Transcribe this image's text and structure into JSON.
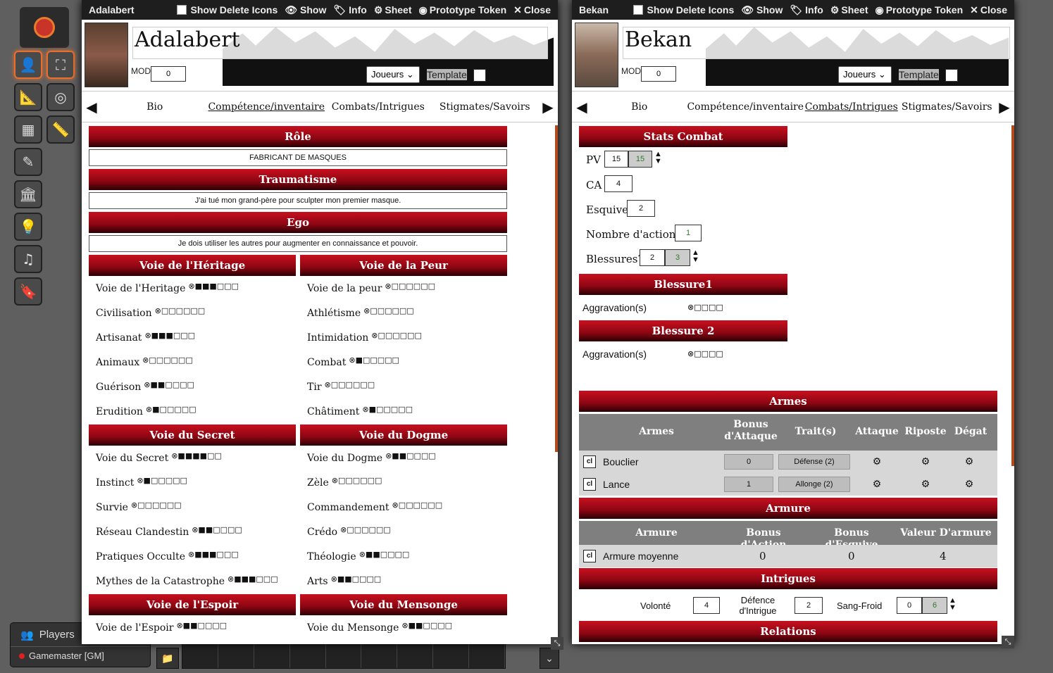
{
  "header_controls": {
    "show_delete": "Show Delete Icons",
    "show": "Show",
    "info": "Info",
    "sheet": "Sheet",
    "proto": "Prototype Token",
    "close": "Close"
  },
  "tabs": {
    "bio": "Bio",
    "comp": "Compétence/inventaire",
    "combat": "Combats/Intrigues",
    "stig": "Stigmates/Savoirs"
  },
  "mod_label": "MOD",
  "template_label": "Template",
  "players": {
    "title": "Players",
    "user": "Gamemaster [GM]"
  },
  "left": {
    "title": "Adalabert",
    "name": "Adalabert",
    "mod": "0",
    "owner": "Joueurs",
    "role_h": "Rôle",
    "role": "FABRICANT DE MASQUES",
    "trauma_h": "Traumatisme",
    "trauma": "J'ai tué mon grand-père pour sculpter mon premier masque.",
    "ego_h": "Ego",
    "ego": "Je dois utiliser les autres pour augmenter en connaissance et pouvoir.",
    "voies": [
      {
        "h": "Voie de l'Héritage",
        "skills": [
          {
            "n": "Voie de l'Heritage",
            "d": "⊗■■■□□□"
          },
          {
            "n": "Civilisation",
            "d": "⊗□□□□□□"
          },
          {
            "n": "Artisanat",
            "d": "⊗■■■□□□"
          },
          {
            "n": "Animaux",
            "d": "⊗□□□□□□"
          },
          {
            "n": "Guérison",
            "d": "⊗■■□□□□"
          },
          {
            "n": "Erudition",
            "d": "⊗■□□□□□"
          }
        ]
      },
      {
        "h": "Voie de la Peur",
        "skills": [
          {
            "n": "Voie de la peur",
            "d": "⊗□□□□□□"
          },
          {
            "n": "Athlétisme",
            "d": "⊗□□□□□□"
          },
          {
            "n": "Intimidation",
            "d": "⊗□□□□□□"
          },
          {
            "n": "Combat",
            "d": "⊗■□□□□□"
          },
          {
            "n": "Tir",
            "d": "⊗□□□□□□"
          },
          {
            "n": "Châtiment",
            "d": "⊗■□□□□□"
          }
        ]
      },
      {
        "h": "Voie du Secret",
        "skills": [
          {
            "n": "Voie du Secret",
            "d": "⊗■■■■□□"
          },
          {
            "n": "Instinct",
            "d": "⊗■□□□□□"
          },
          {
            "n": "Survie",
            "d": "⊗□□□□□□"
          },
          {
            "n": "Réseau Clandestin",
            "d": "⊗■■□□□□"
          },
          {
            "n": "Pratiques Occulte",
            "d": "⊗■■■□□□"
          },
          {
            "n": "Mythes de la Catastrophe",
            "d": "⊗■■■□□□"
          }
        ]
      },
      {
        "h": "Voie du Dogme",
        "skills": [
          {
            "n": "Voie du Dogme",
            "d": "⊗■■□□□□"
          },
          {
            "n": "Zèle",
            "d": "⊗□□□□□□"
          },
          {
            "n": "Commandement",
            "d": "⊗□□□□□□"
          },
          {
            "n": "Crédo",
            "d": "⊗□□□□□□"
          },
          {
            "n": "Théologie",
            "d": "⊗■■□□□□"
          },
          {
            "n": "Arts",
            "d": "⊗■■□□□□"
          }
        ]
      },
      {
        "h": "Voie de l'Espoir",
        "skills": [
          {
            "n": "Voie de l'Espoir",
            "d": "⊗■■□□□□"
          }
        ]
      },
      {
        "h": "Voie du Mensonge",
        "skills": [
          {
            "n": "Voie du Mensonge",
            "d": "⊗■■□□□□"
          }
        ]
      }
    ]
  },
  "right": {
    "title": "Bekan",
    "name": "Bekan",
    "mod": "0",
    "owner": "Joueurs",
    "stats_h": "Stats Combat",
    "pv_l": "PV",
    "pv": "15",
    "pv_max": "15",
    "ca_l": "CA",
    "ca": "4",
    "esq_l": "Esquive",
    "esq": "2",
    "act_l": "Nombre d'actions",
    "act": "1",
    "bl_l": "Blessures?",
    "bl": "2",
    "bl_max": "3",
    "b1_h": "Blessure1",
    "b2_h": "Blessure 2",
    "aggr_l": "Aggravation(s)",
    "aggr_d": "⊗□□□□",
    "armes_h": "Armes",
    "armes_cols": [
      "Armes",
      "Bonus d'Attaque",
      "Trait(s)",
      "Attaque",
      "Riposte",
      "Dégat"
    ],
    "armes": [
      {
        "n": "Bouclier",
        "bonus": "0",
        "trait": "Défense (2)"
      },
      {
        "n": "Lance",
        "bonus": "1",
        "trait": "Allonge (2)"
      }
    ],
    "armure_h": "Armure",
    "armure_cols": [
      "Armure",
      "Bonus d'Action",
      "Bonus d'Esquive",
      "Valeur D'armure"
    ],
    "armure": {
      "n": "Armure moyenne",
      "ba": "0",
      "be": "0",
      "va": "4"
    },
    "intr_h": "Intrigues",
    "vol_l": "Volonté",
    "vol": "4",
    "def_l": "Défence d'Intrigue",
    "def": "2",
    "sf_l": "Sang-Froid",
    "sf": "0",
    "sf_max": "6",
    "rel_h": "Relations"
  }
}
